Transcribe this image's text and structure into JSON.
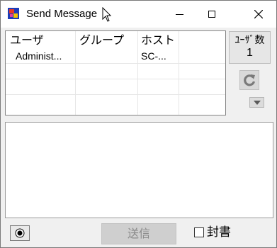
{
  "window": {
    "title": "Send Message"
  },
  "user_list": {
    "columns": [
      "ユーザ",
      "グループ",
      "ホスト"
    ],
    "rows": [
      {
        "user": "Administ...",
        "group": "",
        "host": "SC-..."
      }
    ]
  },
  "user_count": {
    "label": "ﾕｰｻﾞ数",
    "value": "1"
  },
  "bottom_bar": {
    "send_label": "送信",
    "seal_label": "封書",
    "seal_checked": false
  },
  "colors": {
    "window_bg": "#f0f0f0",
    "send_disabled_bg": "#cfcfcf",
    "send_disabled_text": "#8a8a8a",
    "refresh_icon": "#7a7a7a"
  }
}
